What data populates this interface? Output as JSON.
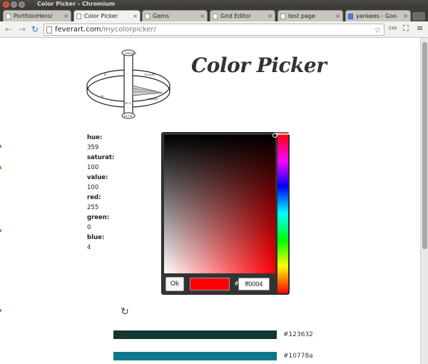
{
  "window": {
    "title": "Color Picker - Chromium"
  },
  "tabs": [
    {
      "label": "PortfolioHero/",
      "active": false,
      "icon": "page-icon"
    },
    {
      "label": "Color Picker",
      "active": true,
      "icon": "page-icon"
    },
    {
      "label": "Gems",
      "active": false,
      "icon": "page-icon"
    },
    {
      "label": "Grid Editor",
      "active": false,
      "icon": "page-icon"
    },
    {
      "label": "test page",
      "active": false,
      "icon": "page-icon"
    },
    {
      "label": "yankees - Goo",
      "active": false,
      "icon": "google-icon"
    }
  ],
  "toolbar": {
    "url_host": "feverart.com",
    "url_path": "/mycolorpicker/",
    "ext_label": "css"
  },
  "page": {
    "title": "Color Picker",
    "logo_letters": {
      "top": "INDIGO",
      "ring_left": "R",
      "ring_right": "VIOLET",
      "ring_front": "GREEN",
      "ring_front_left": "B",
      "bottom": "BLUE",
      "post": "W G"
    }
  },
  "values": [
    {
      "label": "hue:",
      "value": "359"
    },
    {
      "label": "saturat:",
      "value": "100"
    },
    {
      "label": "value:",
      "value": "100"
    },
    {
      "label": "red:",
      "value": "255"
    },
    {
      "label": "green:",
      "value": "0"
    },
    {
      "label": "blue:",
      "value": "4"
    }
  ],
  "picker": {
    "ok_label": "Ok",
    "hash": "#",
    "hex_value": "ff0004",
    "current_color": "#ff0004"
  },
  "colors": [
    {
      "hex": "#123632",
      "label": "#123632"
    },
    {
      "hex": "#10778a",
      "label": "#10778a"
    }
  ]
}
